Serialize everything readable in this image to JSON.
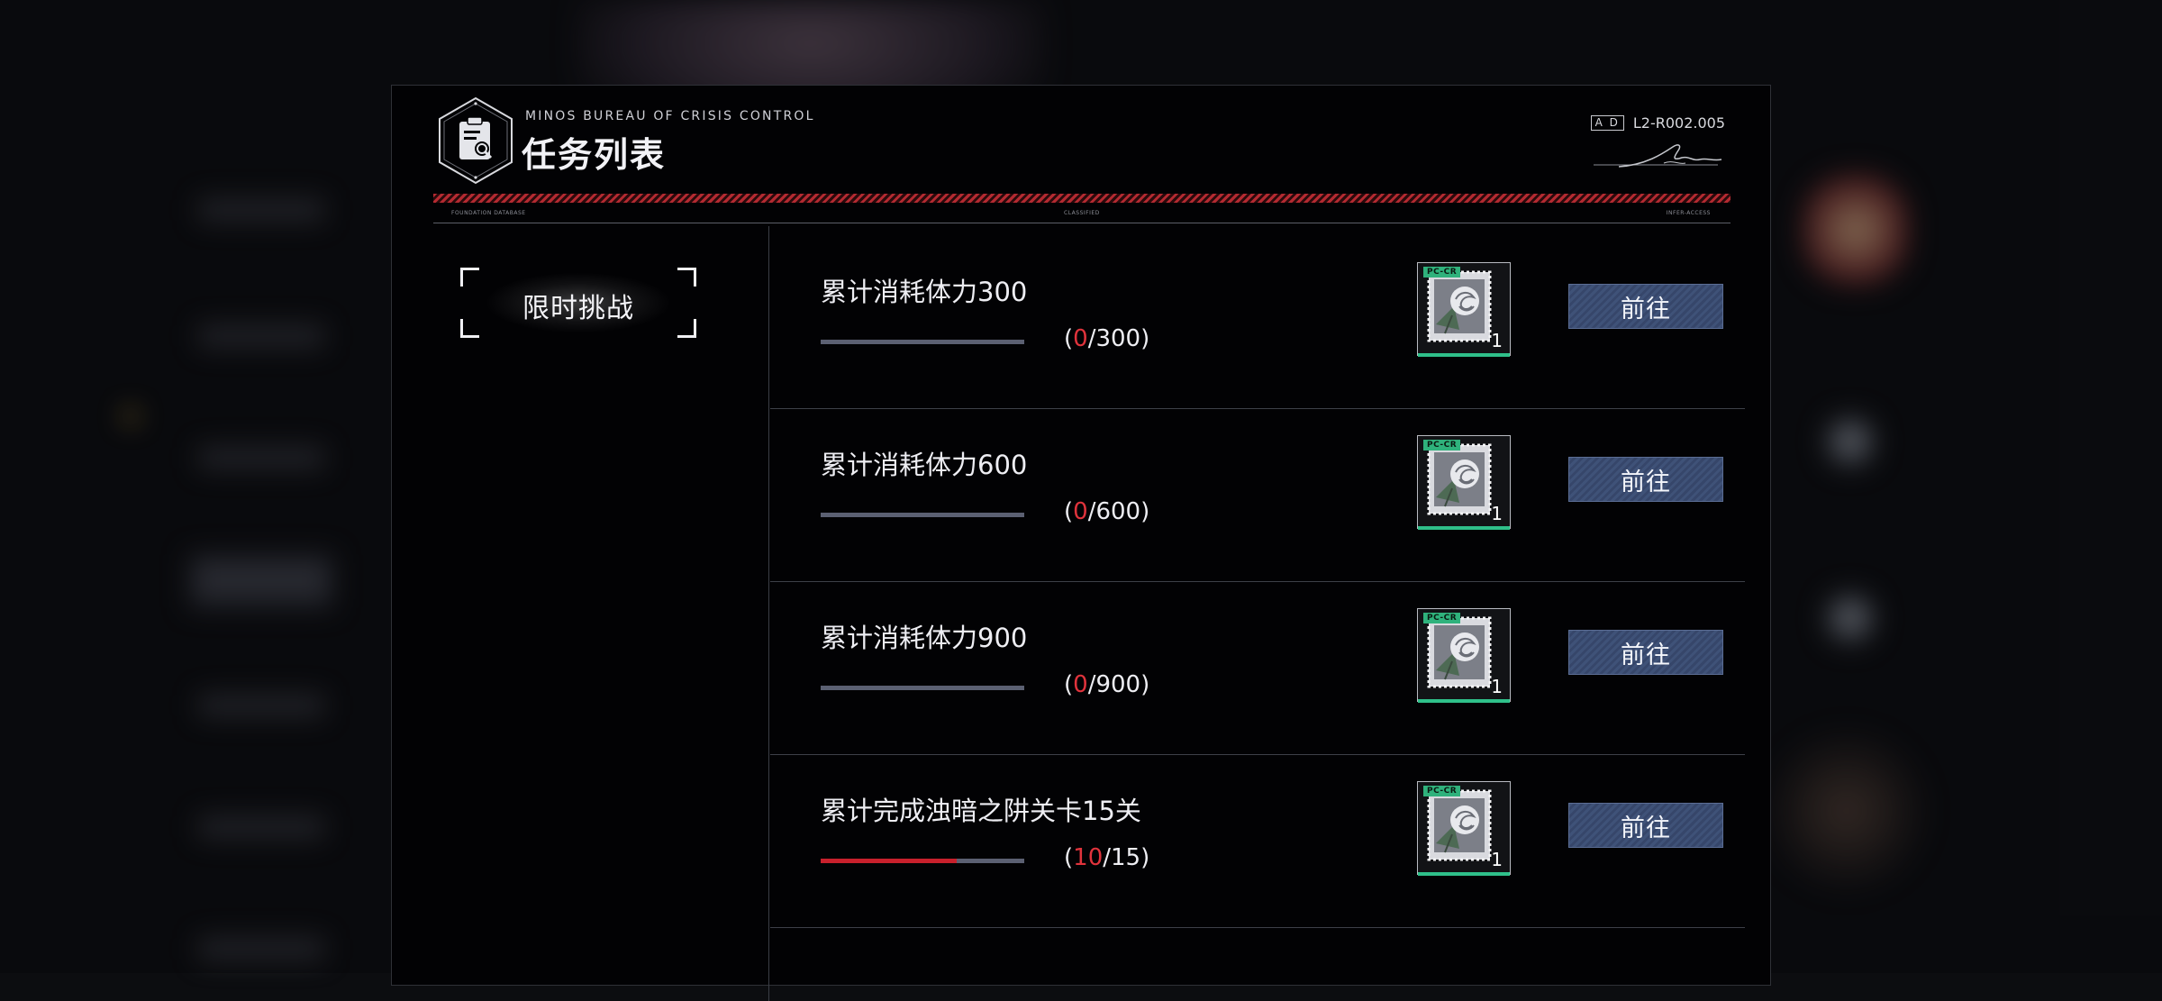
{
  "header": {
    "bureau": "MINOS BUREAU OF CRISIS CONTROL",
    "title": "任务列表",
    "ad_label": "A D",
    "code": "L2-R002.005",
    "sub_left": "FOUNDATION DATABASE",
    "sub_mid": "CLASSIFIED",
    "sub_right": "INFER-ACCESS"
  },
  "category": {
    "label": "限时挑战"
  },
  "tasks": [
    {
      "name": "累计消耗体力300",
      "current": "0",
      "total": "300",
      "progress": 0.0,
      "reward_tag": "PC-CR",
      "reward_qty": "1",
      "button": "前往"
    },
    {
      "name": "累计消耗体力600",
      "current": "0",
      "total": "600",
      "progress": 0.0,
      "reward_tag": "PC-CR",
      "reward_qty": "1",
      "button": "前往"
    },
    {
      "name": "累计消耗体力900",
      "current": "0",
      "total": "900",
      "progress": 0.0,
      "reward_tag": "PC-CR",
      "reward_qty": "1",
      "button": "前往"
    },
    {
      "name": "累计完成浊暗之阱关卡15关",
      "current": "10",
      "total": "15",
      "progress": 0.667,
      "reward_tag": "PC-CR",
      "reward_qty": "1",
      "button": "前往"
    }
  ],
  "colors": {
    "accent_red": "#e0333c",
    "progress_fill": "#c8202c",
    "button_blue": "#3f5278",
    "reward_green": "#2fc08a"
  },
  "icons": {
    "logo": "bureau-shield-icon",
    "reward": "rose-stamp-icon"
  }
}
